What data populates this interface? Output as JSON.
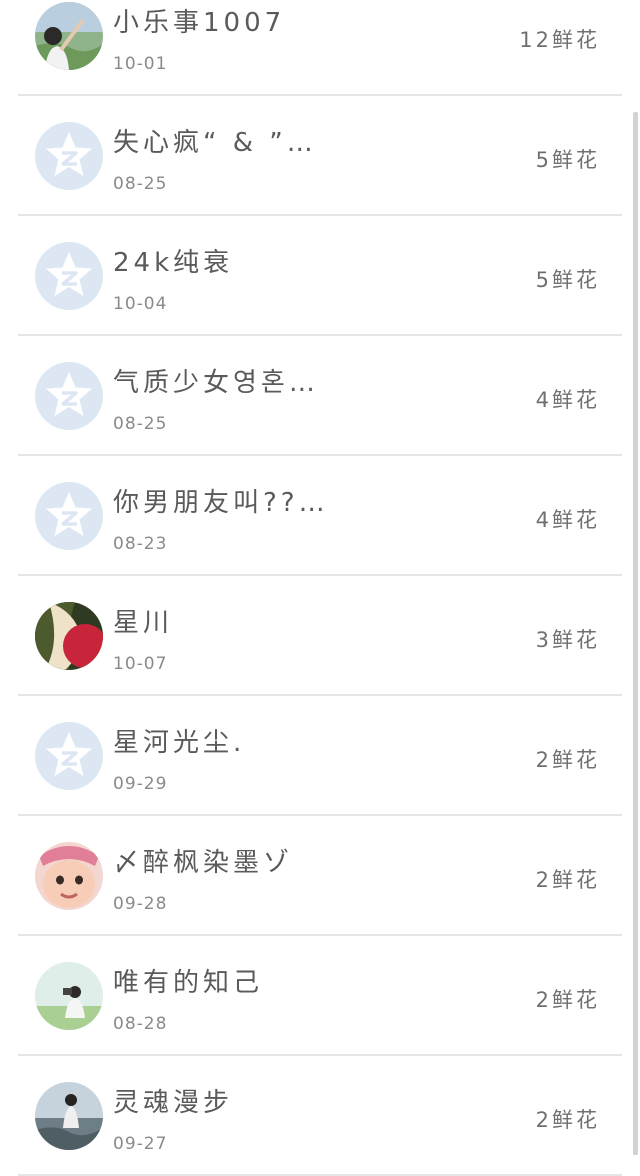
{
  "rows": [
    {
      "name": "小乐事1007",
      "date": "10-01",
      "flowers": "12鲜花",
      "avatar": "photo-landscape-girl"
    },
    {
      "name": "失心疯“ & ”…",
      "date": "08-25",
      "flowers": "5鲜花",
      "avatar": "default-qzone-star-icon"
    },
    {
      "name": "24k纯衰",
      "date": "10-04",
      "flowers": "5鲜花",
      "avatar": "default-qzone-star-icon"
    },
    {
      "name": "气质少女영혼…",
      "date": "08-25",
      "flowers": "4鲜花",
      "avatar": "default-qzone-star-icon"
    },
    {
      "name": "你男朋友叫??…",
      "date": "08-23",
      "flowers": "4鲜花",
      "avatar": "default-qzone-star-icon"
    },
    {
      "name": "星川",
      "date": "10-07",
      "flowers": "3鲜花",
      "avatar": "photo-red-green"
    },
    {
      "name": "星河光尘.",
      "date": "09-29",
      "flowers": "2鲜花",
      "avatar": "default-qzone-star-icon"
    },
    {
      "name": "〆醉枫染墨ゾ",
      "date": "09-28",
      "flowers": "2鲜花",
      "avatar": "photo-baby-face"
    },
    {
      "name": "唯有的知己",
      "date": "08-28",
      "flowers": "2鲜花",
      "avatar": "photo-girl-camera"
    },
    {
      "name": "灵魂漫步",
      "date": "09-27",
      "flowers": "2鲜花",
      "avatar": "photo-girl-stone"
    }
  ],
  "colors": {
    "divider": "#e6e6e6",
    "default_avatar_bg": "#dde7f3",
    "text_name": "#5a5a5a",
    "text_date": "#8a8a8a",
    "text_flowers": "#707070",
    "scrollbar": "#d2d2d2"
  }
}
